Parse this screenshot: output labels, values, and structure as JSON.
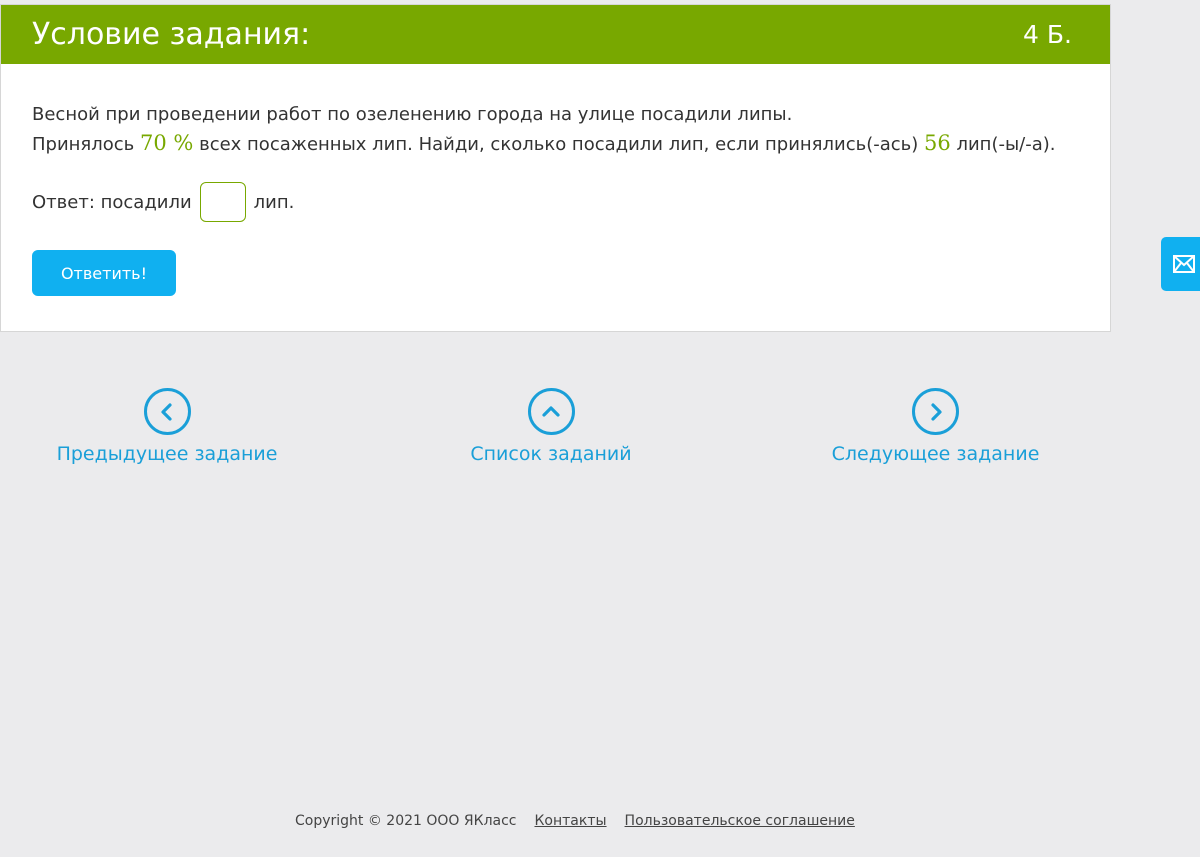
{
  "header": {
    "title": "Условие задания:",
    "points": "4 Б."
  },
  "task": {
    "line1": "Весной при проведении работ по озеленению города на улице посадили липы.",
    "line2_part1": "Принялось ",
    "percent_value": "70 %",
    "line2_part2": " всех посаженных лип. Найди, сколько посадили лип, если принялись(-ась) ",
    "count_value": "56",
    "line2_part3": " лип(-ы/-а)."
  },
  "answer": {
    "prefix": "Ответ: посадили",
    "input_value": "",
    "suffix": "лип."
  },
  "submit_label": "Ответить!",
  "side_tab": {
    "icon": "envelope-icon"
  },
  "navigation": {
    "prev": {
      "label": "Предыдущее задание",
      "icon": "chevron-left-icon"
    },
    "list": {
      "label": "Список заданий",
      "icon": "chevron-up-icon"
    },
    "next": {
      "label": "Следующее задание",
      "icon": "chevron-right-icon"
    }
  },
  "footer": {
    "copyright": "Copyright © 2021 ООО ЯКласс",
    "contacts": "Контакты",
    "agreement": "Пользовательское соглашение"
  },
  "colors": {
    "header_green": "#78a800",
    "button_blue": "#10b0f0",
    "link_blue": "#1a9fd8",
    "background": "#ebebed"
  }
}
